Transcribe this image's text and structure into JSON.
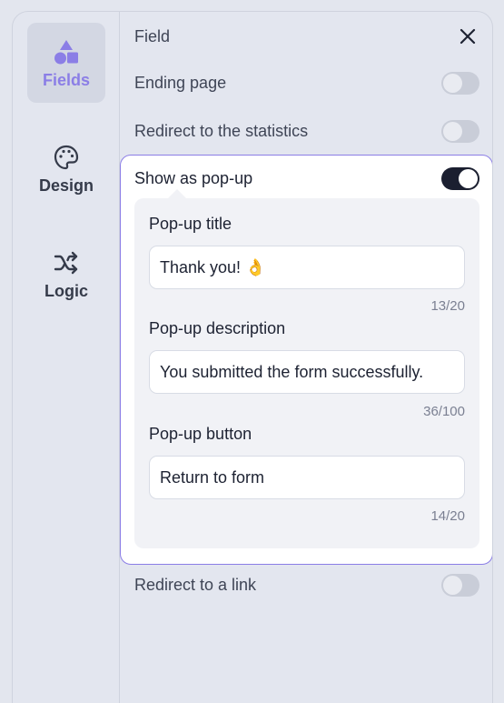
{
  "sidebar": {
    "items": [
      {
        "label": "Fields",
        "icon": "shapes-icon",
        "active": true
      },
      {
        "label": "Design",
        "icon": "palette-icon",
        "active": false
      },
      {
        "label": "Logic",
        "icon": "shuffle-icon",
        "active": false
      }
    ]
  },
  "panel": {
    "title": "Field",
    "toggles": {
      "ending_page": {
        "label": "Ending page",
        "on": false
      },
      "redirect_statistics": {
        "label": "Redirect to the statistics",
        "on": false
      },
      "show_popup": {
        "label": "Show as pop-up",
        "on": true
      },
      "redirect_link": {
        "label": "Redirect to a link",
        "on": false
      }
    },
    "popup": {
      "title_field": {
        "label": "Pop-up title",
        "value": "Thank you! 👌",
        "counter": "13/20"
      },
      "description_field": {
        "label": "Pop-up description",
        "value": "You submitted the form successfully.",
        "counter": "36/100"
      },
      "button_field": {
        "label": "Pop-up button",
        "value": "Return to form",
        "counter": "14/20"
      }
    }
  },
  "colors": {
    "accent": "#8b7ee6",
    "toggle_on": "#1b1f30",
    "toggle_off": "#c9cdd8",
    "background": "#e3e6ef"
  }
}
